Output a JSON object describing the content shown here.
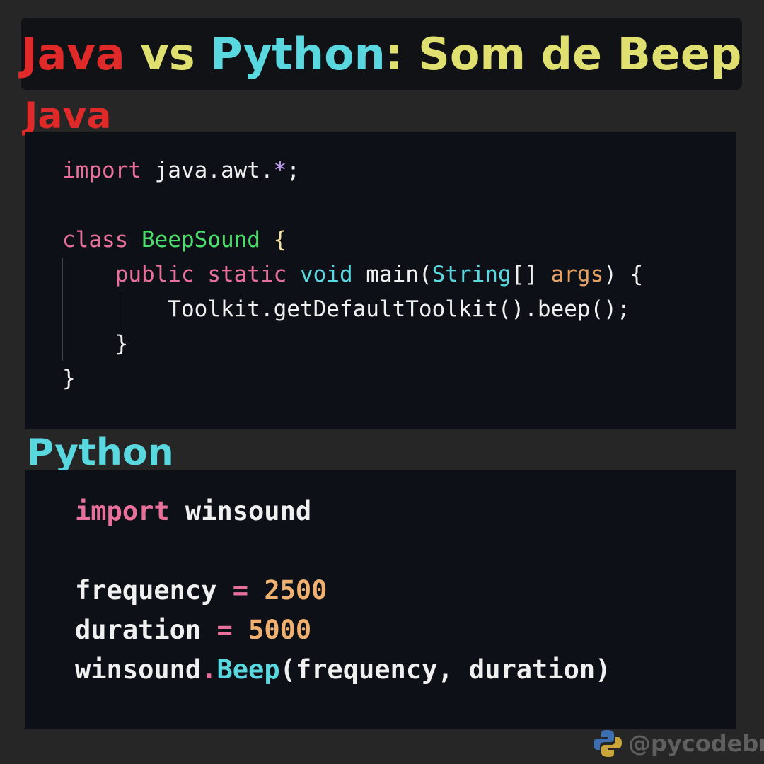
{
  "colors": {
    "java": "#e02a2a",
    "python": "#5ad8e0",
    "yellow": "#e0e070",
    "keyword": "#e8709a",
    "type": "#5ad8e0",
    "class": "#4ade6a",
    "param": "#e8a060",
    "text": "#f0f0f0",
    "number": "#f0b070",
    "punct": "#c9a0ff",
    "brace": "#f0e0a0"
  },
  "title": {
    "parts": [
      {
        "text": "Java",
        "color": "java"
      },
      {
        "text": " vs ",
        "color": "yellow"
      },
      {
        "text": "Python",
        "color": "python"
      },
      {
        "text": ": Som de Beep",
        "color": "yellow"
      }
    ]
  },
  "java": {
    "label": "Java",
    "lines": [
      [
        [
          "import",
          "keyword"
        ],
        [
          " java.awt.",
          "text"
        ],
        [
          "*",
          "punct"
        ],
        [
          ";",
          "text"
        ]
      ],
      [],
      [
        [
          "class",
          "keyword"
        ],
        [
          " ",
          "text"
        ],
        [
          "BeepSound",
          "class"
        ],
        [
          " {",
          "brace"
        ]
      ],
      [
        [
          "    ",
          "text"
        ],
        [
          "public",
          "keyword"
        ],
        [
          " ",
          "text"
        ],
        [
          "static",
          "keyword"
        ],
        [
          " ",
          "text"
        ],
        [
          "void",
          "type"
        ],
        [
          " main(",
          "text"
        ],
        [
          "String",
          "type"
        ],
        [
          "[] ",
          "text"
        ],
        [
          "args",
          "param"
        ],
        [
          ") {",
          "text"
        ]
      ],
      [
        [
          "        Toolkit.getDefaultToolkit().beep();",
          "text"
        ]
      ],
      [
        [
          "    }",
          "text"
        ]
      ],
      [
        [
          "}",
          "text"
        ]
      ]
    ]
  },
  "python": {
    "label": "Python",
    "lines": [
      [
        [
          "import",
          "keyword"
        ],
        [
          " winsound",
          "text"
        ]
      ],
      [],
      [
        [
          "frequency",
          "text"
        ],
        [
          " = ",
          "keyword"
        ],
        [
          "2500",
          "number"
        ]
      ],
      [
        [
          "duration",
          "text"
        ],
        [
          " = ",
          "keyword"
        ],
        [
          "5000",
          "number"
        ]
      ],
      [
        [
          "winsound",
          "text"
        ],
        [
          ".",
          "keyword"
        ],
        [
          "Beep",
          "type"
        ],
        [
          "(frequency, duration)",
          "text"
        ]
      ]
    ]
  },
  "watermark": {
    "handle": "@pycodebr",
    "icon": "python-logo-icon"
  }
}
